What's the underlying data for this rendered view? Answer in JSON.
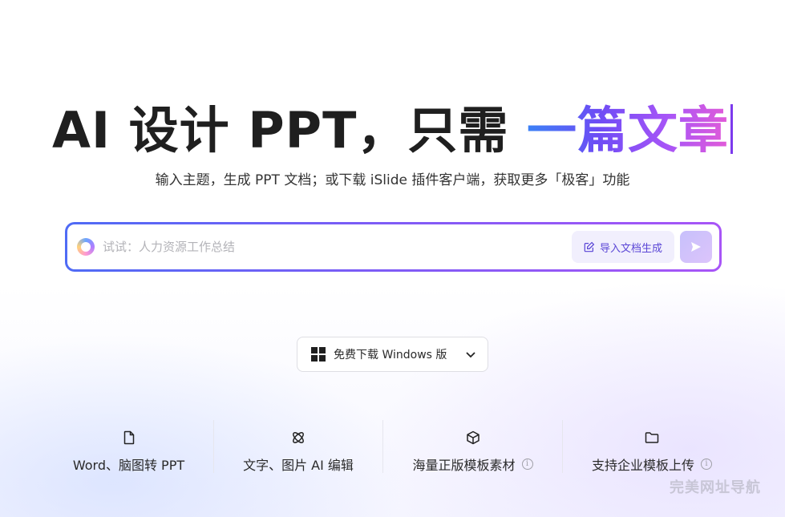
{
  "hero": {
    "title_plain": "AI 设计 PPT，只需 ",
    "title_highlight": "一篇文章"
  },
  "subtitle": "输入主题，生成 PPT 文档；或下载 iSlide 插件客户端，获取更多「极客」功能",
  "search": {
    "placeholder": "试试：人力资源工作总结",
    "value": "",
    "import_label": "导入文档生成"
  },
  "download": {
    "label": "免费下载 Windows 版"
  },
  "features": [
    {
      "icon": "file-icon",
      "label": "Word、脑图转 PPT",
      "info": false
    },
    {
      "icon": "atom-icon",
      "label": "文字、图片 AI 编辑",
      "info": false
    },
    {
      "icon": "cube-icon",
      "label": "海量正版模板素材",
      "info": true
    },
    {
      "icon": "folder-icon",
      "label": "支持企业模板上传",
      "info": true
    }
  ],
  "watermark": "完美网址导航",
  "colors": {
    "accent": "#7b5cf6",
    "gradient_start": "#3b82f6",
    "gradient_end": "#e25bd8"
  }
}
